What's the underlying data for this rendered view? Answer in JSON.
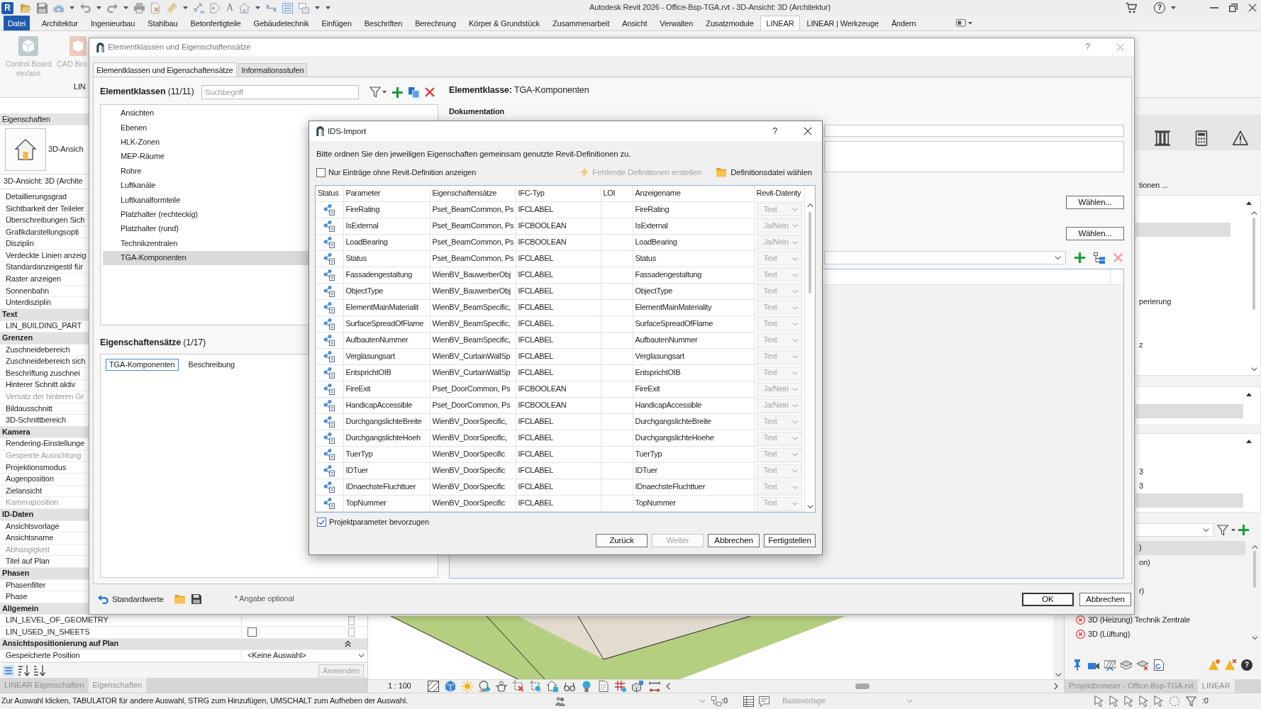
{
  "app": {
    "logo": "R",
    "text_tool": "A",
    "title": "Autodesk Revit 2026 - Office-Bsp-TGA.rvt - 3D-Ansicht: 3D (Architektur)",
    "help": "?"
  },
  "ribbon_tabs": [
    {
      "label": "Datei",
      "kind": "file",
      "selected": false
    },
    {
      "label": "Architektur",
      "kind": "tab",
      "selected": false
    },
    {
      "label": "Ingenieurbau",
      "kind": "tab",
      "selected": false
    },
    {
      "label": "Stahlbau",
      "kind": "tab",
      "selected": false
    },
    {
      "label": "Betonfertigteile",
      "kind": "tab",
      "selected": false
    },
    {
      "label": "Gebäudetechnik",
      "kind": "tab",
      "selected": false
    },
    {
      "label": "Einfügen",
      "kind": "tab",
      "selected": false
    },
    {
      "label": "Beschriften",
      "kind": "tab",
      "selected": false
    },
    {
      "label": "Berechnung",
      "kind": "tab",
      "selected": false
    },
    {
      "label": "Körper & Grundstück",
      "kind": "tab",
      "selected": false
    },
    {
      "label": "Zusammenarbeit",
      "kind": "tab",
      "selected": false
    },
    {
      "label": "Ansicht",
      "kind": "tab",
      "selected": false
    },
    {
      "label": "Verwalten",
      "kind": "tab",
      "selected": false
    },
    {
      "label": "Zusatzmodule",
      "kind": "tab",
      "selected": false
    },
    {
      "label": "LINEAR",
      "kind": "tab",
      "selected": true
    },
    {
      "label": "LINEAR | Werkzeuge",
      "kind": "tab",
      "selected": false
    },
    {
      "label": "Ändern",
      "kind": "tab",
      "selected": false
    }
  ],
  "ribbon": {
    "buttons": [
      {
        "label": "Control Board ein/aus",
        "kind": "board",
        "disabled": true
      },
      {
        "label": "CAD Bro",
        "kind": "cad",
        "disabled": true
      }
    ],
    "panel_label": "LIN"
  },
  "properties": {
    "title": "Eigenschaften",
    "type_name": "3D-Ansich",
    "instance": "3D-Ansicht: 3D (Archite",
    "rows": [
      {
        "kind": "param",
        "label": "Detaillierungsgrad",
        "disabled": false
      },
      {
        "kind": "param",
        "label": "Sichtbarkeit der Teileler",
        "disabled": false
      },
      {
        "kind": "param",
        "label": "Überschreibungen Sich",
        "disabled": false
      },
      {
        "kind": "param",
        "label": "Grafikdarstellungsopti",
        "disabled": false
      },
      {
        "kind": "param",
        "label": "Disziplin",
        "disabled": false
      },
      {
        "kind": "param",
        "label": "Verdeckte Linien anzeig",
        "disabled": false
      },
      {
        "kind": "param",
        "label": "Standardanzeigestil für",
        "disabled": false
      },
      {
        "kind": "param",
        "label": "Raster anzeigen",
        "disabled": false
      },
      {
        "kind": "param",
        "label": "Sonnenbahn",
        "disabled": false
      },
      {
        "kind": "param",
        "label": "Unterdisziplin",
        "disabled": false
      },
      {
        "kind": "group",
        "label": "Text"
      },
      {
        "kind": "param",
        "label": "LIN_BUILDING_PART",
        "disabled": false
      },
      {
        "kind": "group",
        "label": "Grenzen"
      },
      {
        "kind": "param",
        "label": "Zuschneidebereich",
        "disabled": false
      },
      {
        "kind": "param",
        "label": "Zuschneidebereich sich",
        "disabled": false
      },
      {
        "kind": "param",
        "label": "Beschriftung zuschnei",
        "disabled": false
      },
      {
        "kind": "param",
        "label": "Hinterer Schnitt aktiv",
        "disabled": false
      },
      {
        "kind": "param",
        "label": "Versatz der hinteren Gr",
        "disabled": true
      },
      {
        "kind": "param",
        "label": "Bildausschnitt",
        "disabled": false
      },
      {
        "kind": "param",
        "label": "3D-Schnittbereich",
        "disabled": false
      },
      {
        "kind": "group",
        "label": "Kamera"
      },
      {
        "kind": "param",
        "label": "Rendering-Einstellunge",
        "disabled": false
      },
      {
        "kind": "param",
        "label": "Gesperrte Ausrichtung",
        "disabled": true
      },
      {
        "kind": "param",
        "label": "Projektionsmodus",
        "disabled": false
      },
      {
        "kind": "param",
        "label": "Augenposition",
        "disabled": false
      },
      {
        "kind": "param",
        "label": "Zielansicht",
        "disabled": false
      },
      {
        "kind": "param",
        "label": "Kameraposition",
        "disabled": true
      },
      {
        "kind": "group",
        "label": "ID-Daten"
      },
      {
        "kind": "param",
        "label": "Ansichtsvorlage",
        "disabled": false
      },
      {
        "kind": "param",
        "label": "Ansichtsname",
        "disabled": false
      },
      {
        "kind": "param",
        "label": "Abhängigkeit",
        "disabled": true
      },
      {
        "kind": "param",
        "label": "Titel auf Plan",
        "disabled": false
      },
      {
        "kind": "group",
        "label": "Phasen"
      },
      {
        "kind": "param",
        "label": "Phasenfilter",
        "disabled": false
      },
      {
        "kind": "param",
        "label": "Phase",
        "disabled": false
      },
      {
        "kind": "group",
        "label": "Allgemein"
      },
      {
        "kind": "param",
        "label": "LIN_LEVEL_OF_GEOMETRY",
        "disabled": false,
        "edit_button": true
      },
      {
        "kind": "param",
        "label": "LIN_USED_IN_SHEETS",
        "disabled": false,
        "checked": false,
        "edit_button": true
      },
      {
        "kind": "group",
        "label": "Ansichtspositionierung auf Plan",
        "expanded": true
      },
      {
        "kind": "param",
        "label": "Gespeicherte Position",
        "disabled": false,
        "value": "<Keine Auswahl>"
      }
    ],
    "apply": {
      "label": "Anwenden",
      "disabled": true
    },
    "tabs": [
      {
        "label": "LINEAR Eigenschaften",
        "selected": false
      },
      {
        "label": "Eigenschaften",
        "selected": true
      }
    ]
  },
  "view": {
    "scale": "1 : 100"
  },
  "right_panel": {
    "caption": "tionen ...",
    "lists": [
      {
        "items": [
          {
            "selected": true
          },
          {
            "selected": false
          },
          {
            "selected": false
          },
          {
            "selected": false
          },
          {
            "selected": false
          },
          {
            "text": "perierung",
            "selected": false
          },
          {
            "selected": false
          },
          {
            "selected": false
          },
          {
            "text": "z",
            "selected": false
          }
        ]
      },
      {
        "items": [
          {
            "selected": true
          }
        ]
      },
      {
        "items": [
          {
            "selected": false
          },
          {
            "text": "3",
            "selected": false
          },
          {
            "text": "3",
            "selected": false
          },
          {
            "selected": true
          }
        ]
      }
    ],
    "browser": {
      "items": [
        {
          "text": ")",
          "kind": "cut",
          "selected": true
        },
        {
          "text": "on)",
          "kind": "cut",
          "selected": false
        },
        {
          "selected": false,
          "kind": "cut"
        },
        {
          "text": "r)",
          "kind": "cut",
          "selected": false
        },
        {
          "selected": false,
          "kind": "cut"
        },
        {
          "text": "3D (Heizung) Technik Zentrale",
          "kind": "full",
          "selected": false,
          "error": true
        },
        {
          "text": "3D (Lüftung)",
          "kind": "full",
          "selected": false,
          "error": true
        }
      ]
    },
    "help": "?",
    "tabs": [
      {
        "label": "Projektbrowser - Office-Bsp-TGA.rvt",
        "selected": false
      },
      {
        "label": "LINEAR",
        "selected": true
      }
    ]
  },
  "status_bar": {
    "hint": "Zur Auswahl klicken, TABULATOR für andere Auswahl, STRG zum Hinzufügen, UMSCHALT zum Aufheben der Auswahl.",
    "worksharing_count": ":0",
    "design_option": {
      "value": "Basisvorlage",
      "disabled": true
    },
    "filter_count": ":0"
  },
  "element_dialog": {
    "title": "Elementklassen und Eigenschaftensätze",
    "help": "?",
    "tabs": [
      {
        "label": "Elementklassen und Eigenschaftensätze",
        "selected": true
      },
      {
        "label": "Informationsstufen",
        "selected": false
      }
    ],
    "classes": {
      "heading": "**Elementklassen** (11/11)",
      "search": {
        "placeholder": "Suchbegriff"
      },
      "items": [
        {
          "label": "Ansichten",
          "selected": false
        },
        {
          "label": "Ebenen",
          "selected": false
        },
        {
          "label": "HLK-Zonen",
          "selected": false
        },
        {
          "label": "MEP-Räume",
          "selected": false
        },
        {
          "label": "Rohre",
          "selected": false
        },
        {
          "label": "Luftkanäle",
          "selected": false
        },
        {
          "label": "Luftkanalformteile",
          "selected": false
        },
        {
          "label": "Platzhalter (rechteckig)",
          "selected": false
        },
        {
          "label": "Platzhalter (rund)",
          "selected": false
        },
        {
          "label": "Technikzentralen",
          "selected": false
        },
        {
          "label": "TGA-Komponenten",
          "selected": true
        }
      ]
    },
    "property_sets": {
      "heading": "**Eigenschaftensätze** (1/17)",
      "columns": [
        {
          "label": "TGA-Komponenten",
          "selected": true
        },
        {
          "label": "Beschreibung",
          "selected": false
        }
      ]
    },
    "detail": {
      "heading": "**Elementklasse:** TGA-Komponenten",
      "section": "Dokumentation",
      "buttons": [
        "Wählen...",
        "Wählen..."
      ]
    },
    "footer": {
      "reset": "Standardwerte",
      "note": "* Angabe optional",
      "buttons": [
        {
          "label": "OK",
          "kind": "default"
        },
        {
          "label": "Abbrechen",
          "kind": "normal"
        }
      ]
    }
  },
  "ids_dialog": {
    "title": "IDS-Import",
    "help": "?",
    "instruction": "Bitte ordnen Sie den jeweiligen Eigenschaften gemeinsam genutzte Revit-Definitionen zu.",
    "filter": {
      "label": "Nur Einträge ohne Revit-Definition anzeigen",
      "checked": false
    },
    "actions": [
      {
        "label": "Fehlende Definitionen erstellen",
        "kind": "create",
        "disabled": true
      },
      {
        "label": "Definitionsdatei wählen",
        "kind": "file",
        "disabled": false
      }
    ],
    "table": {
      "columns": [
        "Status",
        "Parameter",
        "Eigenschaftensätze",
        "IFC-Typ",
        "LOI",
        "Anzeigename",
        "Revit-Datenty"
      ],
      "rows": [
        {
          "parameter": "FireRating",
          "property_sets": "Pset_BeamCommon, Ps",
          "ifc_type": "IFCLABEL",
          "display_name": "FireRating",
          "data_type": "Text",
          "type_disabled": true
        },
        {
          "parameter": "IsExternal",
          "property_sets": "Pset_BeamCommon, Ps",
          "ifc_type": "IFCBOOLEAN",
          "display_name": "IsExternal",
          "data_type": "Ja/Nein",
          "type_disabled": true
        },
        {
          "parameter": "LoadBearing",
          "property_sets": "Pset_BeamCommon, Ps",
          "ifc_type": "IFCBOOLEAN",
          "display_name": "LoadBearing",
          "data_type": "Ja/Nein",
          "type_disabled": true
        },
        {
          "parameter": "Status",
          "property_sets": "Pset_BeamCommon, Ps",
          "ifc_type": "IFCLABEL",
          "display_name": "Status",
          "data_type": "Text",
          "type_disabled": true
        },
        {
          "parameter": "Fassadengestaltung",
          "property_sets": "WienBV_BauwerberObj",
          "ifc_type": "IFCLABEL",
          "display_name": "Fassadengestaltung",
          "data_type": "Text",
          "type_disabled": true
        },
        {
          "parameter": "ObjectType",
          "property_sets": "WienBV_BauwerberObj",
          "ifc_type": "IFCLABEL",
          "display_name": "ObjectType",
          "data_type": "Text",
          "type_disabled": true
        },
        {
          "parameter": "ElementMainMaterialit",
          "property_sets": "WienBV_BeamSpecific,",
          "ifc_type": "IFCLABEL",
          "display_name": "ElementMainMateriality",
          "data_type": "Text",
          "type_disabled": true
        },
        {
          "parameter": "SurfaceSpreadOfFlame",
          "property_sets": "WienBV_BeamSpecific,",
          "ifc_type": "IFCLABEL",
          "display_name": "SurfaceSpreadOfFlame",
          "data_type": "Text",
          "type_disabled": true
        },
        {
          "parameter": "AufbautenNummer",
          "property_sets": "WienBV_BeamSpecific,",
          "ifc_type": "IFCLABEL",
          "display_name": "AufbautenNummer",
          "data_type": "Text",
          "type_disabled": true
        },
        {
          "parameter": "Verglasungsart",
          "property_sets": "WienBV_CurtainWallSp",
          "ifc_type": "IFCLABEL",
          "display_name": "Verglasungsart",
          "data_type": "Text",
          "type_disabled": true
        },
        {
          "parameter": "EntsprichtOIB",
          "property_sets": "WienBV_CurtainWallSp",
          "ifc_type": "IFCLABEL",
          "display_name": "EntsprichtOIB",
          "data_type": "Text",
          "type_disabled": true
        },
        {
          "parameter": "FireExit",
          "property_sets": "Pset_DoorCommon, Ps",
          "ifc_type": "IFCBOOLEAN",
          "display_name": "FireExit",
          "data_type": "Ja/Nein",
          "type_disabled": true
        },
        {
          "parameter": "HandicapAccessible",
          "property_sets": "Pset_DoorCommon, Ps",
          "ifc_type": "IFCBOOLEAN",
          "display_name": "HandicapAccessible",
          "data_type": "Ja/Nein",
          "type_disabled": true
        },
        {
          "parameter": "DurchgangslichteBreite",
          "property_sets": "WienBV_DoorSpecific,",
          "ifc_type": "IFCLABEL",
          "display_name": "DurchgangslichteBreite",
          "data_type": "Text",
          "type_disabled": true
        },
        {
          "parameter": "DurchgangslichteHoeh",
          "property_sets": "WienBV_DoorSpecific,",
          "ifc_type": "IFCLABEL",
          "display_name": "DurchgangslichteHoehe",
          "data_type": "Text",
          "type_disabled": true
        },
        {
          "parameter": "TuerTyp",
          "property_sets": "WienBV_DoorSpecific",
          "ifc_type": "IFCLABEL",
          "display_name": "TuerTyp",
          "data_type": "Text",
          "type_disabled": true
        },
        {
          "parameter": "IDTuer",
          "property_sets": "WienBV_DoorSpecific",
          "ifc_type": "IFCLABEL",
          "display_name": "IDTuer",
          "data_type": "Text",
          "type_disabled": true
        },
        {
          "parameter": "IDnaechsteFluchttuer",
          "property_sets": "WienBV_DoorSpecific",
          "ifc_type": "IFCLABEL",
          "display_name": "IDnaechsteFluchttuer",
          "data_type": "Text",
          "type_disabled": true
        },
        {
          "parameter": "TopNummer",
          "property_sets": "WienBV_DoorSpecific",
          "ifc_type": "IFCLABEL",
          "display_name": "TopNummer",
          "data_type": "Text",
          "type_disabled": true
        }
      ]
    },
    "prefer": {
      "label": "Projektparameter bevorzugen",
      "checked": true
    },
    "buttons": [
      {
        "label": "Zurück",
        "disabled": false
      },
      {
        "label": "Weiter",
        "disabled": true
      },
      {
        "label": "Abbrechen",
        "disabled": false
      },
      {
        "label": "Fertigstellen",
        "disabled": false
      }
    ]
  }
}
